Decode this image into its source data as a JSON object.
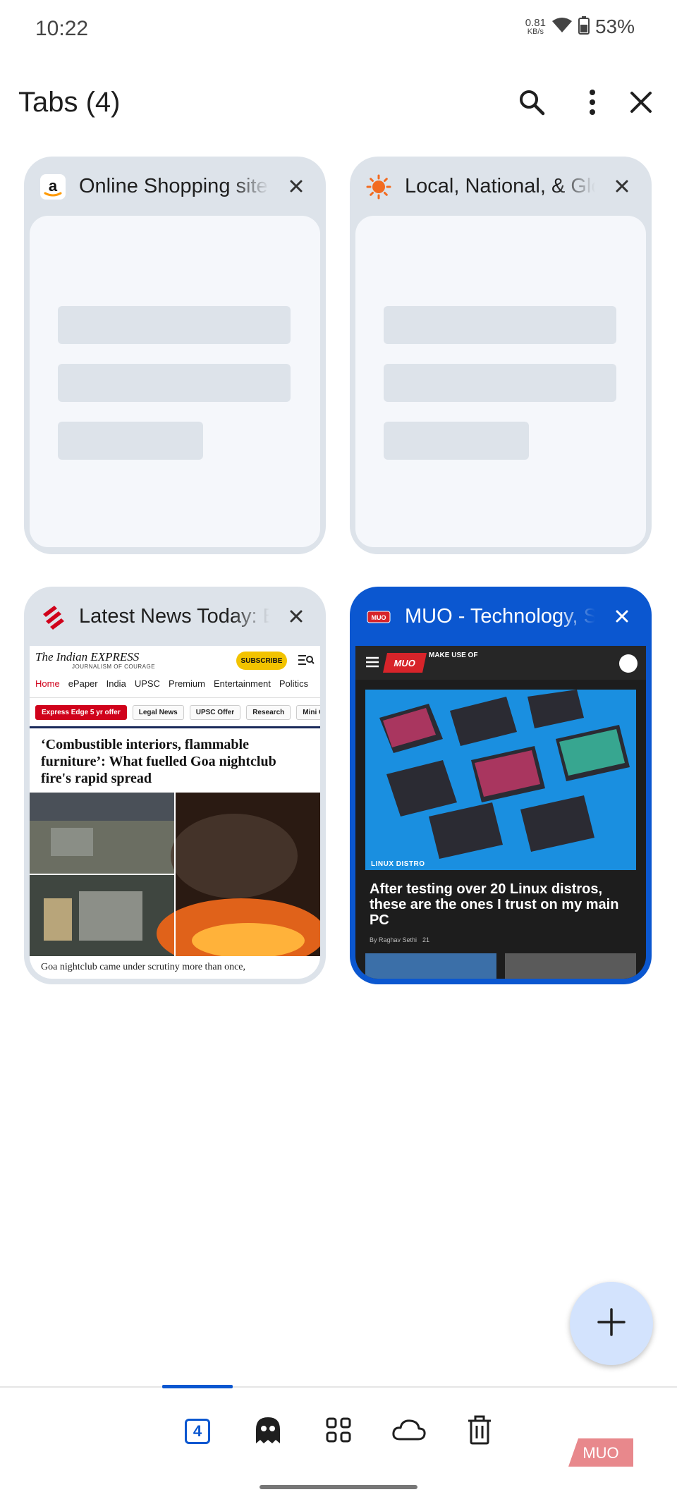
{
  "status_bar": {
    "time": "10:22",
    "net_speed_value": "0.81",
    "net_speed_unit": "KB/s",
    "battery_percent": "53%"
  },
  "header": {
    "title": "Tabs (4)",
    "icons": [
      "search-icon",
      "more-vert-icon",
      "close-icon"
    ]
  },
  "tabs": [
    {
      "title": "Online Shopping site in India: Shop Online for Mobiles",
      "favicon": "amazon-favicon",
      "thumbnail": "loading-placeholder",
      "selected": false
    },
    {
      "title": "Local, National, & Global Daily Weather Forecast",
      "favicon": "weather-sun-favicon",
      "thumbnail": "loading-placeholder",
      "selected": false
    },
    {
      "title": "Latest News Today: Breaking News and Top Headlines",
      "favicon": "indian-express-favicon",
      "thumbnail": "indian-express-page",
      "selected": false,
      "page": {
        "logo": "The Indian EXPRESS",
        "tagline": "JOURNALISM OF COURAGE",
        "subscribe": "SUBSCRIBE",
        "nav": [
          "Home",
          "ePaper",
          "India",
          "UPSC",
          "Premium",
          "Entertainment",
          "Politics"
        ],
        "chips": [
          "Express Edge 5 yr offer",
          "Legal News",
          "UPSC Offer",
          "Research",
          "Mini C"
        ],
        "headline": "‘Combustible interiors, flammable furniture’: What fuelled Goa nightclub fire's rapid spread",
        "caption": "Goa nightclub came under scrutiny more than once,"
      }
    },
    {
      "title": "MUO - Technology, Simplified.",
      "favicon": "muo-favicon",
      "thumbnail": "muo-page",
      "selected": true,
      "page": {
        "logo": "MUO",
        "logo_text": "MAKE USE OF",
        "category": "LINUX DISTRO",
        "headline": "After testing over 20 Linux distros, these are the ones I trust on my main PC",
        "author": "By Raghav Sethi",
        "comments": "21"
      }
    }
  ],
  "fab": {
    "icon": "plus-icon"
  },
  "bottom_bar": {
    "tab_count": "4",
    "icons": [
      "tab-count-icon",
      "incognito-ghost-icon",
      "tab-groups-grid-icon",
      "cloud-sync-icon",
      "trash-icon"
    ],
    "accent_color": "#0b57d0"
  },
  "watermark": "MUO",
  "colors": {
    "accent": "#0b57d0",
    "card_bg": "#dde3ea",
    "fab_bg": "#d3e3fd"
  }
}
